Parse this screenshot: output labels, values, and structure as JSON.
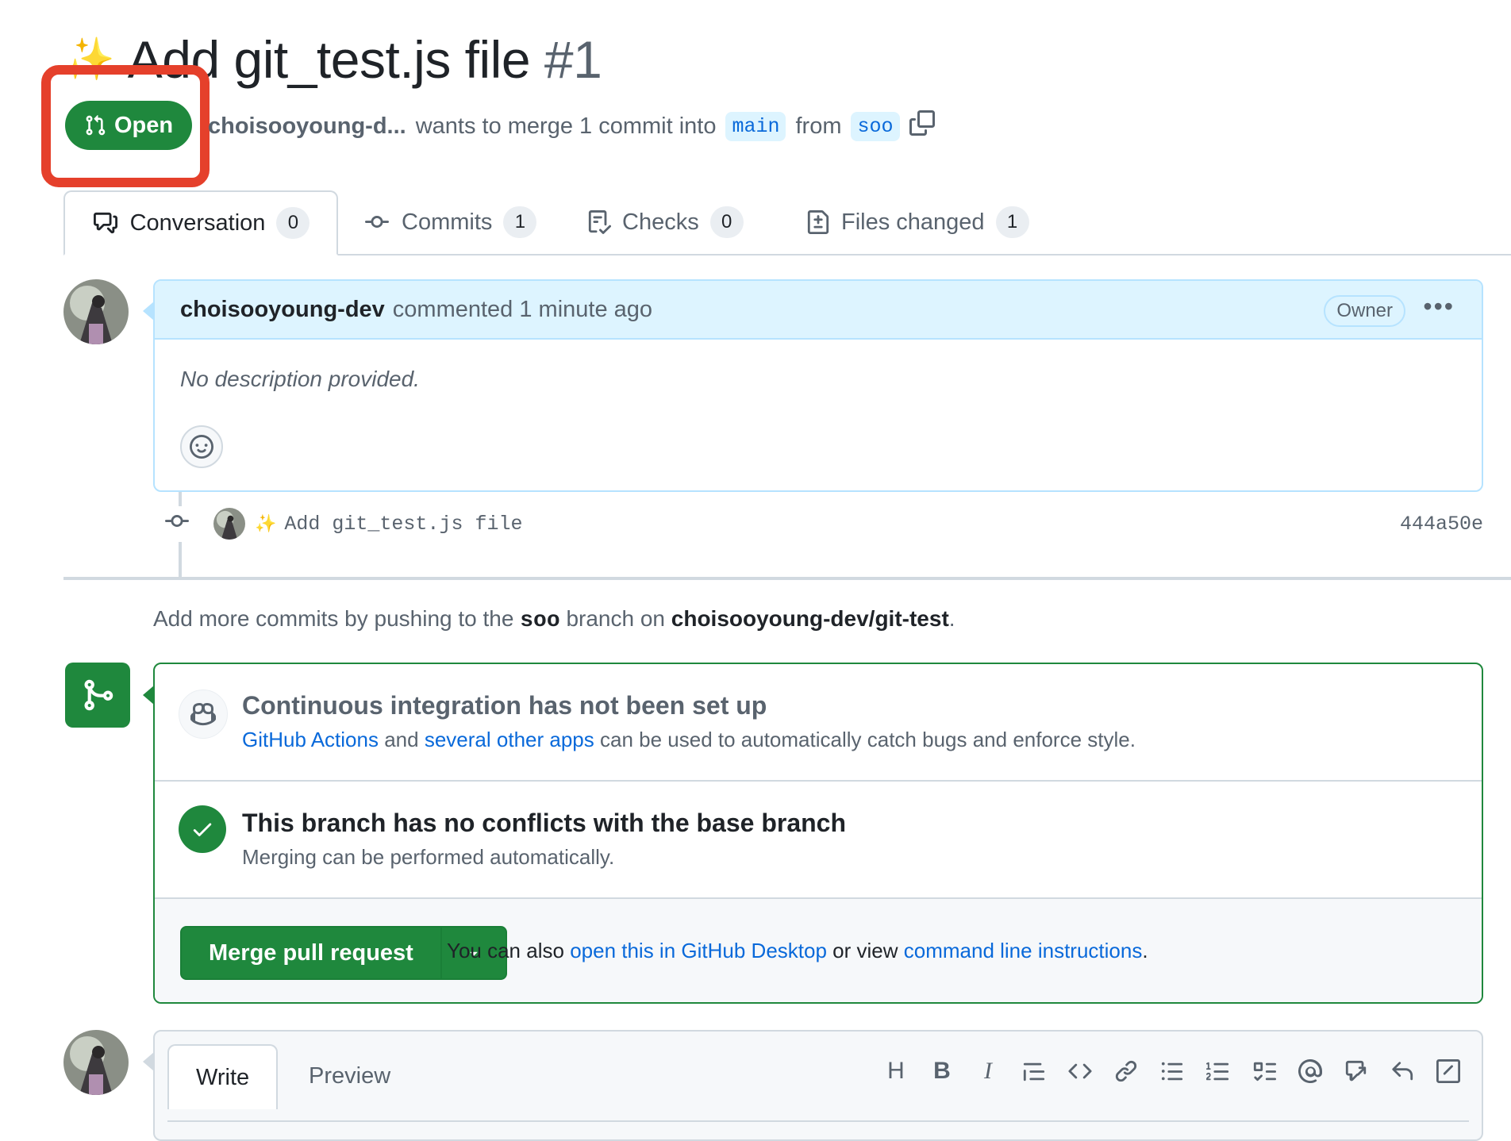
{
  "pr": {
    "title": "Add git_test.js file",
    "number": "#1",
    "state": "Open",
    "author": "choisooyoung-d...",
    "merge_text": "wants to merge 1 commit into",
    "base_branch": "main",
    "from_text": "from",
    "head_branch": "soo"
  },
  "tabs": [
    {
      "label": "Conversation",
      "count": "0"
    },
    {
      "label": "Commits",
      "count": "1"
    },
    {
      "label": "Checks",
      "count": "0"
    },
    {
      "label": "Files changed",
      "count": "1"
    }
  ],
  "comment": {
    "author": "choisooyoung-dev",
    "action": "commented 1 minute ago",
    "role": "Owner",
    "body": "No description provided."
  },
  "commit": {
    "message": "Add git_test.js file",
    "sha": "444a50e"
  },
  "push_note": {
    "prefix": "Add more commits by pushing to the",
    "branch": "soo",
    "middle": "branch on",
    "repo": "choisooyoung-dev/git-test",
    "suffix": "."
  },
  "merge": {
    "ci_title": "Continuous integration has not been set up",
    "ci_link1": "GitHub Actions",
    "ci_and": "and",
    "ci_link2": "several other apps",
    "ci_rest": "can be used to automatically catch bugs and enforce style.",
    "conflict_title": "This branch has no conflicts with the base branch",
    "conflict_sub": "Merging can be performed automatically.",
    "button": "Merge pull request",
    "alt_prefix": "You can also",
    "alt_link1": "open this in GitHub Desktop",
    "alt_mid": "or view",
    "alt_link2": "command line instructions",
    "alt_suffix": "."
  },
  "editor": {
    "write_tab": "Write",
    "preview_tab": "Preview",
    "heading_glyph": "H",
    "bold_glyph": "B",
    "italic_glyph": "I"
  },
  "colors": {
    "open_green": "#1f883d",
    "highlight_red": "#e5402b",
    "link_blue": "#0969da"
  }
}
